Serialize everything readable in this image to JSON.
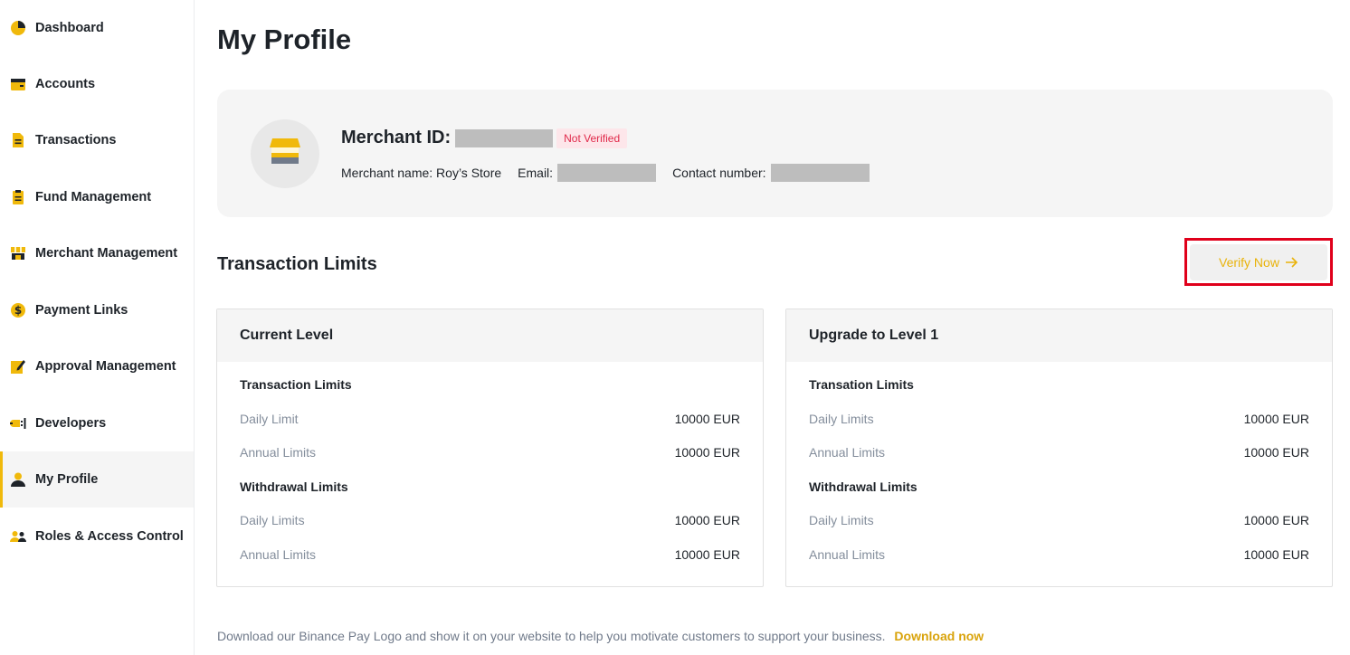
{
  "sidebar": {
    "items": [
      {
        "label": "Dashboard",
        "icon": "dashboard-pie-icon"
      },
      {
        "label": "Accounts",
        "icon": "wallet-icon"
      },
      {
        "label": "Transactions",
        "icon": "document-icon"
      },
      {
        "label": "Fund Management",
        "icon": "clipboard-icon"
      },
      {
        "label": "Merchant Management",
        "icon": "store-icon"
      },
      {
        "label": "Payment Links",
        "icon": "dollar-coin-icon"
      },
      {
        "label": "Approval Management",
        "icon": "edit-pencil-icon"
      },
      {
        "label": "Developers",
        "icon": "plug-icon"
      },
      {
        "label": "My Profile",
        "icon": "user-icon",
        "active": true
      },
      {
        "label": "Roles & Access Control",
        "icon": "users-icon"
      }
    ]
  },
  "page": {
    "title": "My Profile"
  },
  "profile": {
    "merchant_id_label": "Merchant ID:",
    "status_badge": "Not Verified",
    "merchant_name": "Merchant name: Roy’s Store",
    "email_label": "Email:",
    "contact_label": "Contact number:"
  },
  "limits": {
    "section_title": "Transaction Limits",
    "verify_button": "Verify Now",
    "current": {
      "title": "Current Level",
      "group1_title": "Transaction Limits",
      "group1_rows": [
        {
          "label": "Daily Limit",
          "value": "10000 EUR"
        },
        {
          "label": "Annual Limits",
          "value": "10000 EUR"
        }
      ],
      "group2_title": "Withdrawal Limits",
      "group2_rows": [
        {
          "label": "Daily Limits",
          "value": "10000 EUR"
        },
        {
          "label": "Annual Limits",
          "value": "10000 EUR"
        }
      ]
    },
    "upgrade": {
      "title": "Upgrade to Level 1",
      "group1_title": "Transation Limits",
      "group1_rows": [
        {
          "label": "Daily Limits",
          "value": "10000 EUR"
        },
        {
          "label": "Annual Limits",
          "value": "10000 EUR"
        }
      ],
      "group2_title": "Withdrawal Limits",
      "group2_rows": [
        {
          "label": "Daily Limits",
          "value": "10000 EUR"
        },
        {
          "label": "Annual Limits",
          "value": "10000 EUR"
        }
      ]
    }
  },
  "footer": {
    "text": "Download our Binance Pay Logo and show it on your website to help you motivate customers to support your business.",
    "link": "Download now"
  },
  "colors": {
    "accent": "#f0b90b",
    "danger": "#e0294a",
    "highlight_frame": "#e0001b"
  }
}
